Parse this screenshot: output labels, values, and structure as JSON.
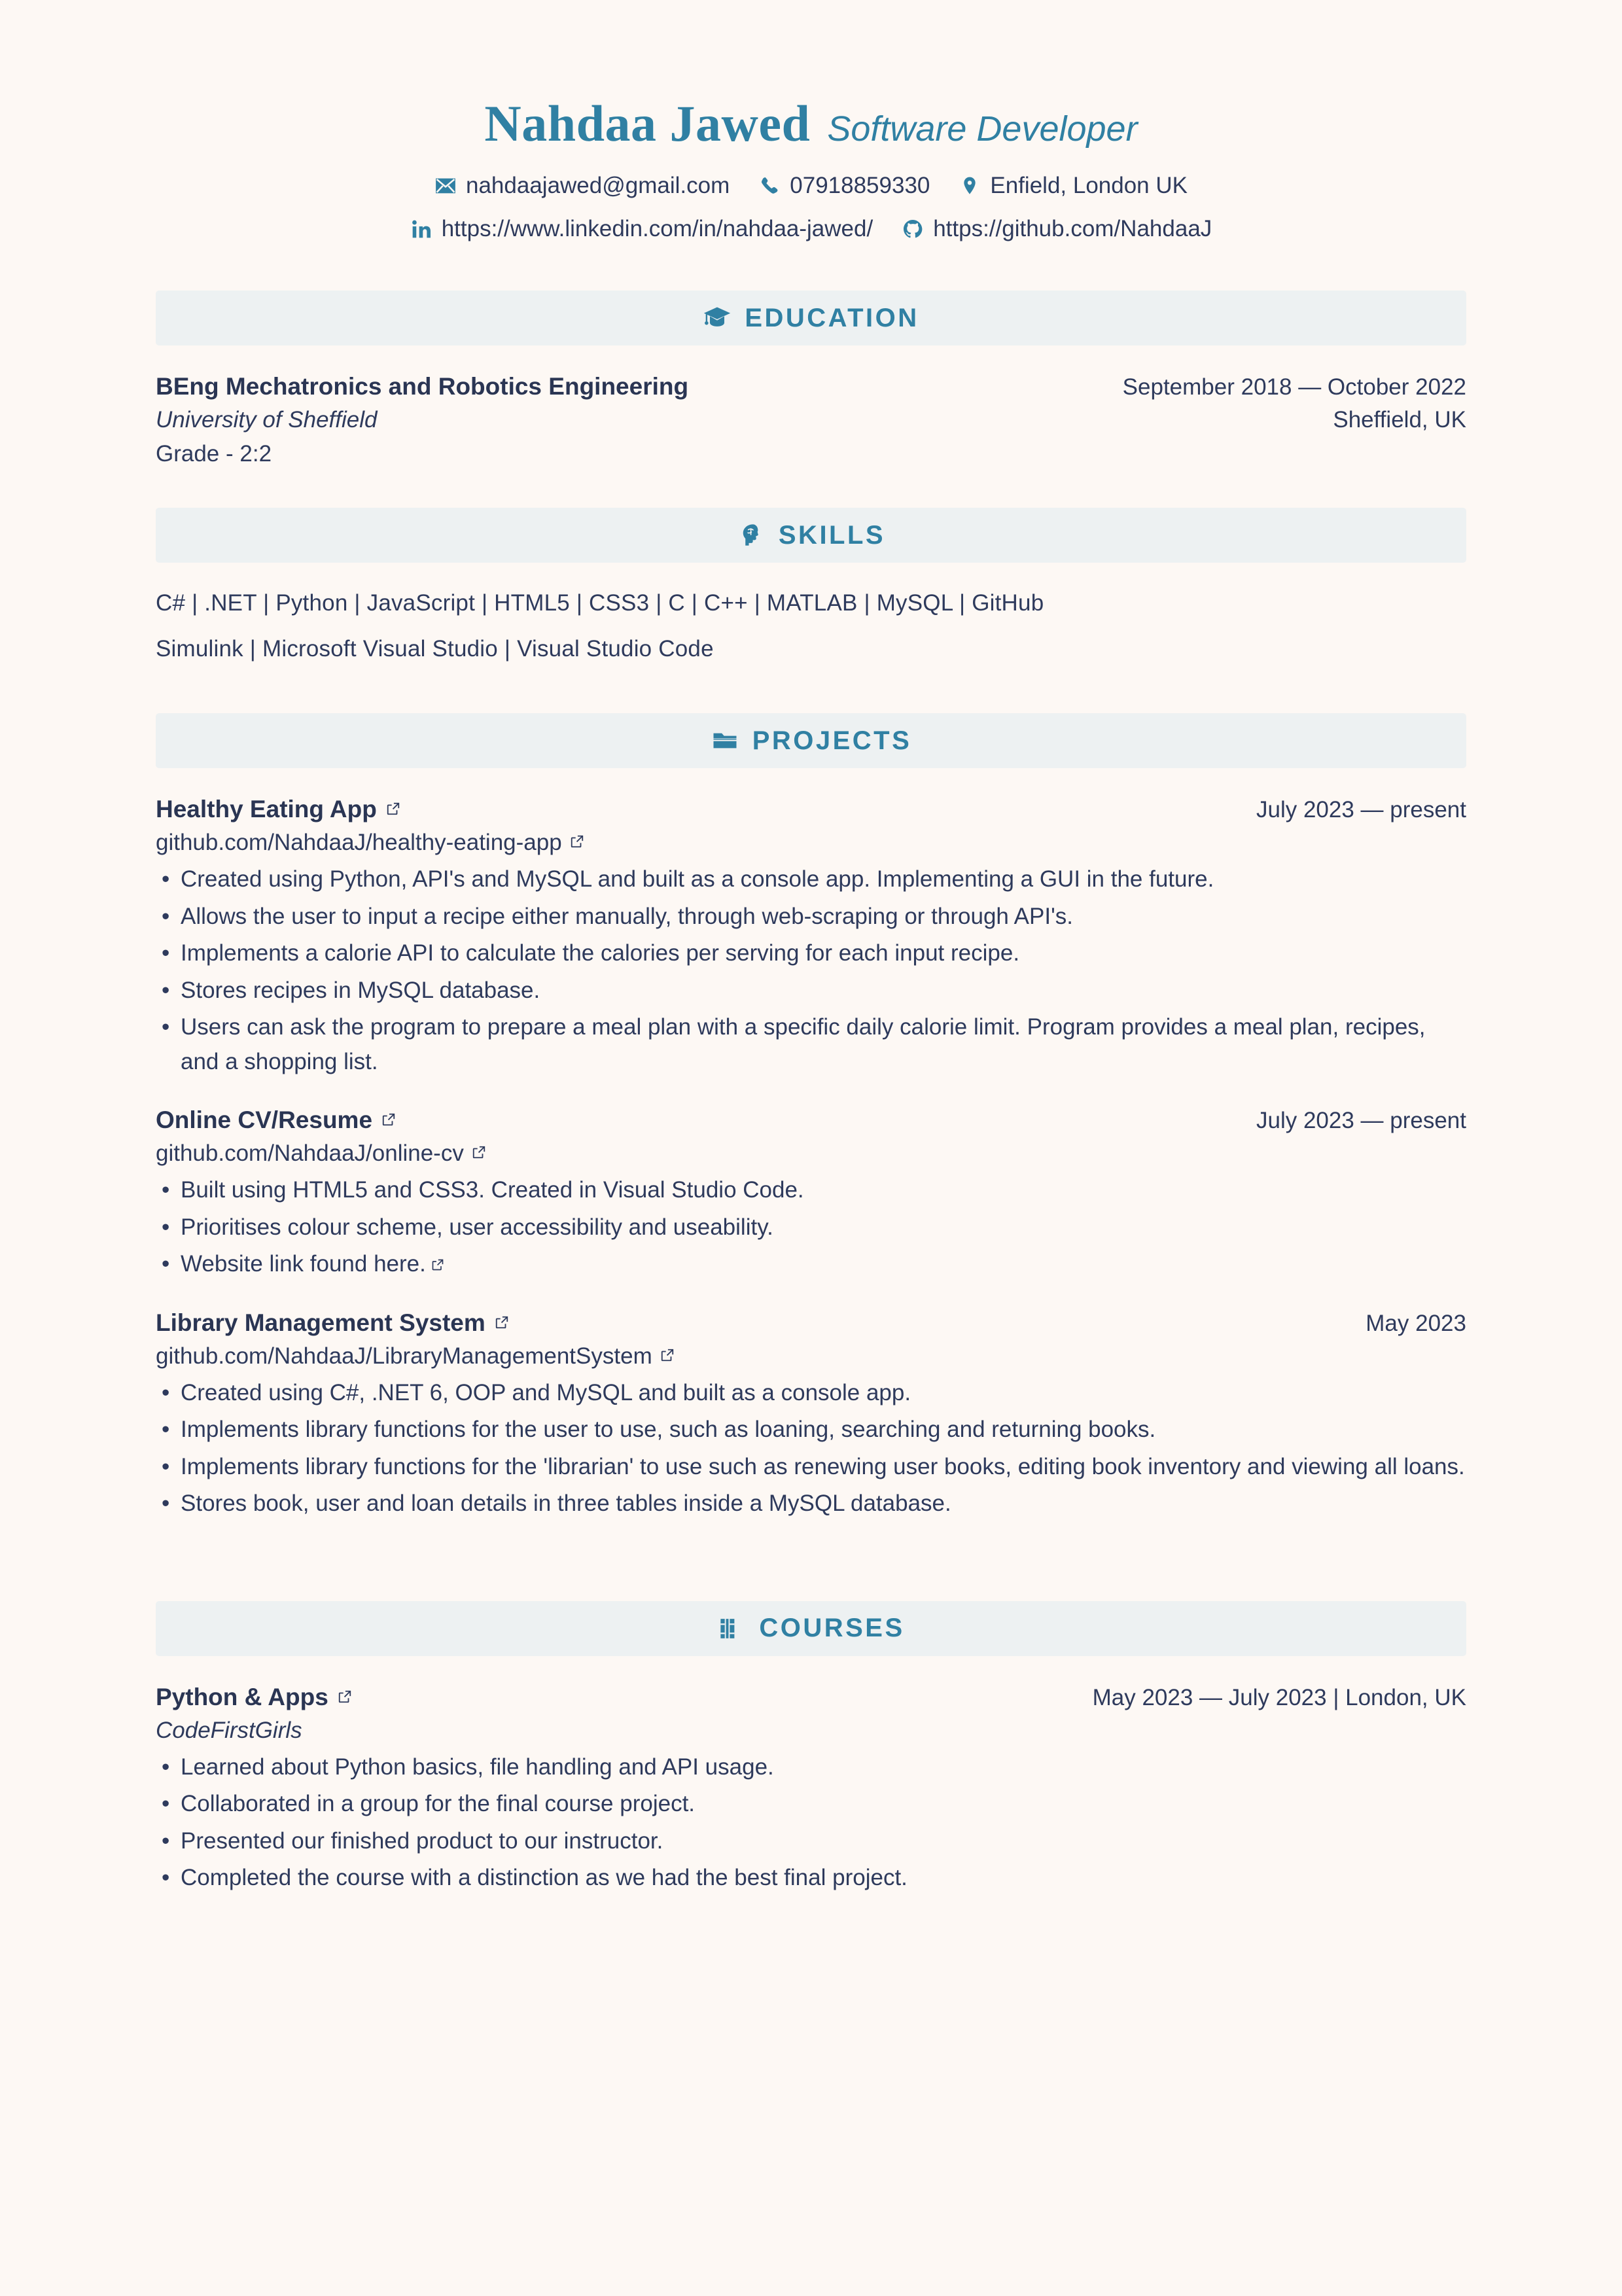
{
  "header": {
    "name": "Nahdaa Jawed",
    "title": "Software Developer",
    "contacts_row1": [
      {
        "icon": "email-icon",
        "text": "nahdaajawed@gmail.com"
      },
      {
        "icon": "phone-icon",
        "text": "07918859330"
      },
      {
        "icon": "location-pin-icon",
        "text": "Enfield, London UK"
      }
    ],
    "contacts_row2": [
      {
        "icon": "linkedin-icon",
        "text": "https://www.linkedin.com/in/nahdaa-jawed/"
      },
      {
        "icon": "github-icon",
        "text": "https://github.com/NahdaaJ"
      }
    ]
  },
  "sections": {
    "education": {
      "icon": "graduation-cap-icon",
      "label": "EDUCATION",
      "entry": {
        "degree": "BEng Mechatronics and Robotics Engineering",
        "dates": "September 2018 — October 2022",
        "institution": "University of Sheffield",
        "location": "Sheffield, UK",
        "grade": "Grade - 2:2"
      }
    },
    "skills": {
      "icon": "brain-head-icon",
      "label": "SKILLS",
      "line1": "C#  |  .NET  |  Python  |  JavaScript  |  HTML5  |  CSS3  |  C  |  C++  |  MATLAB  |  MySQL  |  GitHub",
      "line2": "Simulink  |  Microsoft Visual Studio  |  Visual Studio Code"
    },
    "projects": {
      "icon": "folder-icon",
      "label": "PROJECTS",
      "items": [
        {
          "title": "Healthy Eating App",
          "dates": "July 2023 — present",
          "repo": "github.com/NahdaaJ/healthy-eating-app",
          "bullets": [
            "Created using Python, API's and MySQL and built as a console app. Implementing a GUI in the future.",
            "Allows the user to input a recipe either manually, through web-scraping or through API's.",
            "Implements a calorie API to calculate the calories per serving for each input recipe.",
            "Stores recipes in MySQL database.",
            "Users can ask the program to prepare a meal plan with a specific daily calorie limit. Program provides a meal plan, recipes, and a shopping list."
          ]
        },
        {
          "title": "Online CV/Resume",
          "dates": "July 2023 — present",
          "repo": "github.com/NahdaaJ/online-cv",
          "bullets": [
            "Built using HTML5 and CSS3. Created in Visual Studio Code.",
            "Prioritises colour scheme, user accessibility and useability.",
            "Website link found here."
          ],
          "last_bullet_has_link": true
        },
        {
          "title": "Library Management System",
          "dates": "May 2023",
          "repo": "github.com/NahdaaJ/LibraryManagementSystem",
          "bullets": [
            "Created using C#, .NET 6, OOP and MySQL and built as a console app.",
            "Implements library functions for the user to use, such as loaning, searching and returning books.",
            "Implements library functions for the 'librarian' to use such as renewing user books, editing book inventory and viewing all loans.",
            "Stores book, user and loan details in three tables inside a MySQL database."
          ]
        }
      ]
    },
    "courses": {
      "icon": "books-icon",
      "label": "COURSES",
      "items": [
        {
          "title": "Python & Apps",
          "dates": "May 2023 — July 2023  |  London, UK",
          "provider": "CodeFirstGirls",
          "bullets": [
            "Learned about Python basics, file handling and API usage.",
            "Collaborated in a group for the final course project.",
            "Presented our finished product to our instructor.",
            "Completed the course with a distinction as we had the best final project."
          ]
        }
      ]
    }
  },
  "colors": {
    "background": "#fdf8f4",
    "accent": "#3080a3",
    "text": "#2e3a5c",
    "section_bar": "#edf1f2"
  }
}
